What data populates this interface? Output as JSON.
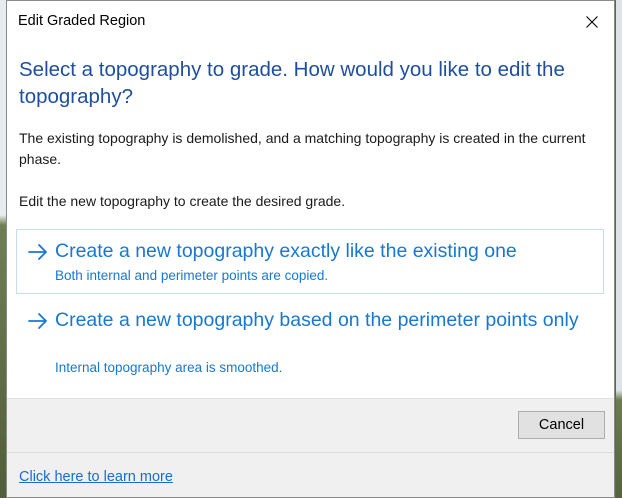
{
  "window": {
    "title": "Edit Graded Region",
    "close_icon": "close-icon"
  },
  "main": {
    "instruction": "Select a topography to grade. How would you like to edit the topography?",
    "content_paragraph_1": "The existing topography is demolished, and a matching topography is created in the current phase.",
    "content_paragraph_2": "Edit the new topography to create the desired grade."
  },
  "options": [
    {
      "icon": "arrow-right-icon",
      "title": "Create a new topography exactly like the existing one",
      "subtitle": "Both internal and perimeter points are copied."
    },
    {
      "icon": "arrow-right-icon",
      "title": "Create a new topography based on the perimeter points only",
      "subtitle": "Internal topography area is smoothed."
    }
  ],
  "buttons": {
    "cancel": "Cancel"
  },
  "footer": {
    "learn_more_link": "Click here to learn more"
  },
  "colors": {
    "instruction_blue": "#1e4f9e",
    "link_blue": "#1878d1",
    "hover_border": "#c9dcee",
    "footer_bg": "#f0f0f0"
  }
}
